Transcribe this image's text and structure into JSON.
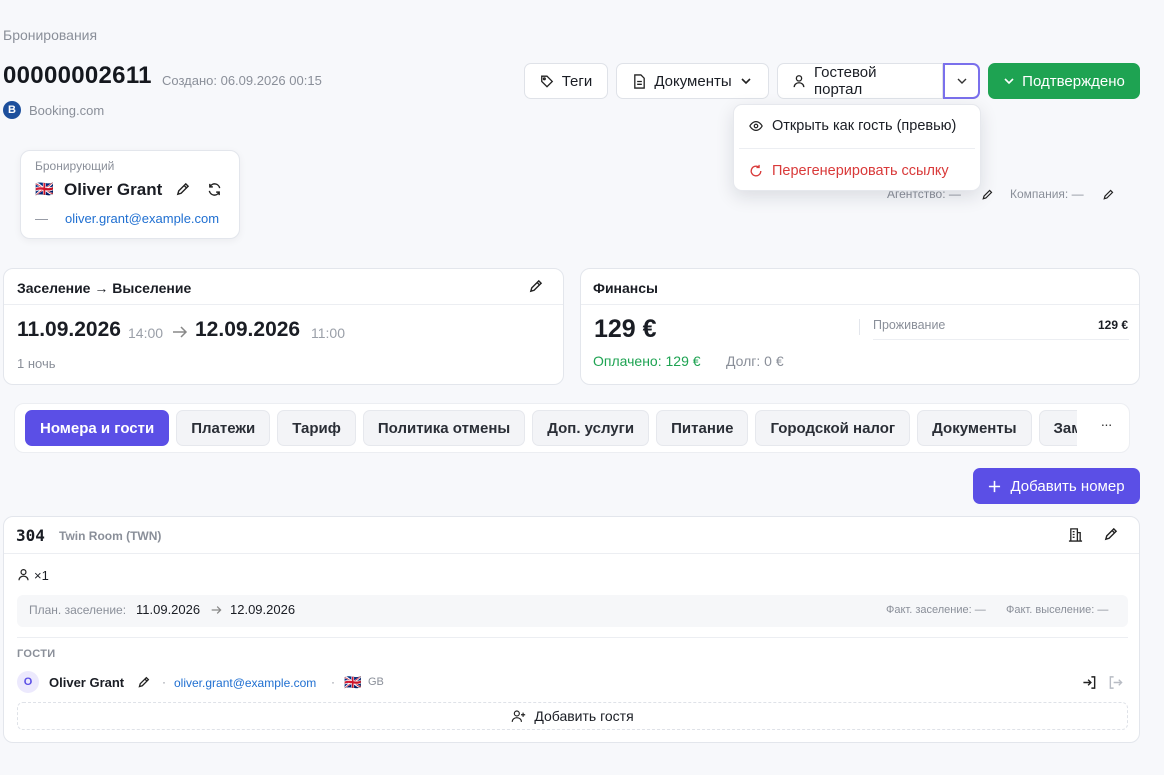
{
  "breadcrumb": "Бронирования",
  "booking": {
    "number": "00000002611",
    "created": "Создано: 06.09.2026 00:15",
    "source_initial": "B",
    "source": "Booking.com"
  },
  "toolbar": {
    "tags": "Теги",
    "documents": "Документы",
    "guest_portal": "Гостевой портал",
    "status": "Подтверждено"
  },
  "dropdown": {
    "open_as_guest": "Открыть как гость (превью)",
    "regenerate": "Перегенерировать ссылку"
  },
  "booker": {
    "label": "Бронирующий",
    "flag": "🇬🇧",
    "name": "Oliver Grant",
    "dash": "—",
    "email": "oliver.grant@example.com"
  },
  "agency": {
    "agency_label": "Агентство: —",
    "company_label": "Компания: —"
  },
  "stay": {
    "title": "Заселение → Выселение",
    "checkin_date": "11.09.2026",
    "checkin_time": "14:00",
    "checkout_date": "12.09.2026",
    "checkout_time": "11:00",
    "nights": "1 ночь"
  },
  "finance": {
    "title": "Финансы",
    "total": "129 €",
    "paid": "Оплачено: 129 €",
    "debt": "Долг: 0 €",
    "line_label": "Проживание",
    "line_value": "129 €"
  },
  "tabs": [
    "Номера и гости",
    "Платежи",
    "Тариф",
    "Политика отмены",
    "Доп. услуги",
    "Питание",
    "Городской налог",
    "Документы",
    "Заметки"
  ],
  "tabs_more": "···",
  "add_room": "Добавить номер",
  "room": {
    "number": "304",
    "type": "Twin Room (TWN)",
    "occupancy": "×1",
    "plan_label": "План. заселение:",
    "plan_from": "11.09.2026",
    "plan_to": "12.09.2026",
    "fact_in": "Факт. заселение: —",
    "fact_out": "Факт. выселение: —",
    "guests_title": "ГОСТИ",
    "add_guest": "Добавить гостя"
  },
  "guest": {
    "initial": "O",
    "name": "Oliver Grant",
    "email": "oliver.grant@example.com",
    "flag": "🇬🇧",
    "country": "GB"
  },
  "colors": {
    "accent": "#5b4fe6",
    "success": "#1ea352",
    "danger": "#d93a3a",
    "link": "#1f6fd1"
  },
  "icons": [
    "tag-icon",
    "document-icon",
    "chevron-down-icon",
    "user-icon",
    "eye-icon",
    "refresh-icon",
    "pencil-icon",
    "arrow-right-icon",
    "plus-icon",
    "building-icon",
    "login-icon",
    "logout-icon",
    "add-user-icon"
  ]
}
